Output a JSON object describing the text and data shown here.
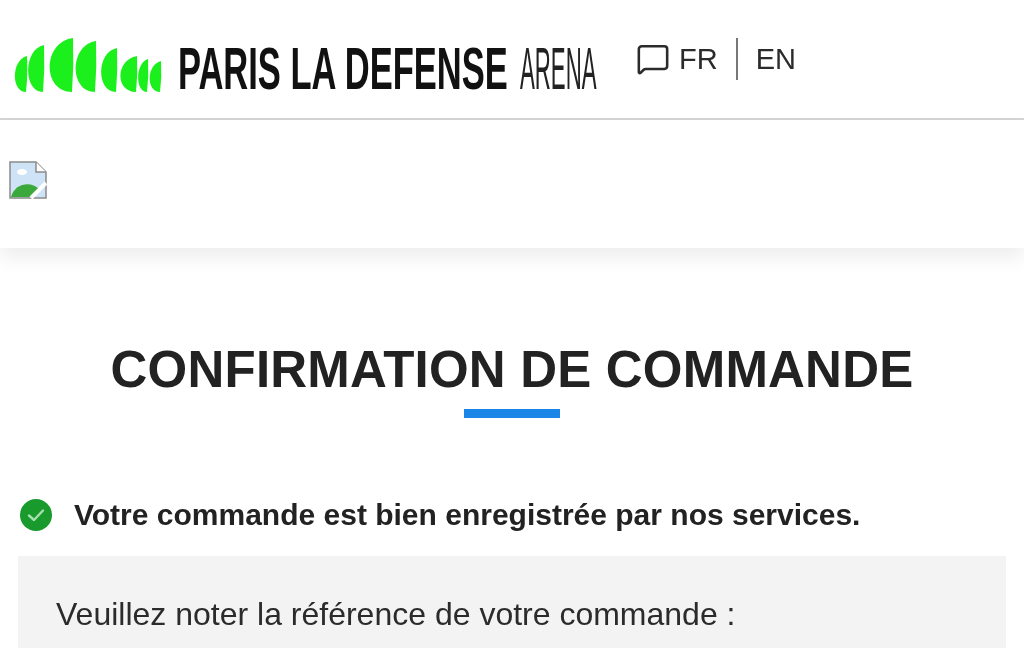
{
  "header": {
    "logo": {
      "title": "PARIS LA DEFENSE",
      "subtitle": "ARENA"
    },
    "languages": [
      "FR",
      "EN"
    ]
  },
  "page": {
    "title": "CONFIRMATION DE COMMANDE",
    "status": {
      "kind": "success",
      "message": "Votre commande est bien enregistrée par nos services."
    },
    "reference_box": {
      "text": "Veuillez noter la référence de votre commande :"
    }
  }
}
